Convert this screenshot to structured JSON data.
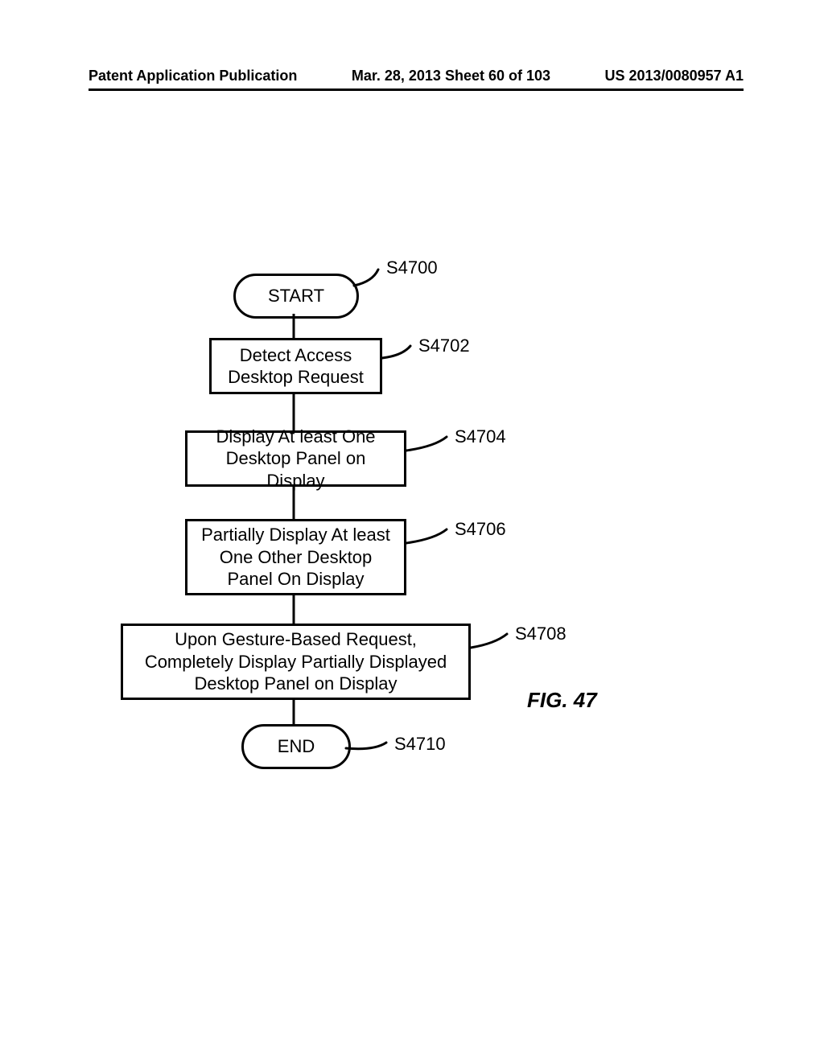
{
  "header": {
    "left": "Patent Application Publication",
    "center": "Mar. 28, 2013  Sheet 60 of 103",
    "right": "US 2013/0080957 A1"
  },
  "flowchart": {
    "start": "START",
    "end": "END",
    "steps": [
      {
        "ref": "S4700",
        "text": ""
      },
      {
        "ref": "S4702",
        "text": "Detect Access Desktop Request"
      },
      {
        "ref": "S4704",
        "text": "Display At least One Desktop Panel on Display"
      },
      {
        "ref": "S4706",
        "text": "Partially Display At least One Other Desktop Panel On Display"
      },
      {
        "ref": "S4708",
        "text": "Upon Gesture-Based Request, Completely Display Partially Displayed Desktop Panel on Display"
      },
      {
        "ref": "S4710",
        "text": ""
      }
    ]
  },
  "figure_caption": "FIG. 47"
}
